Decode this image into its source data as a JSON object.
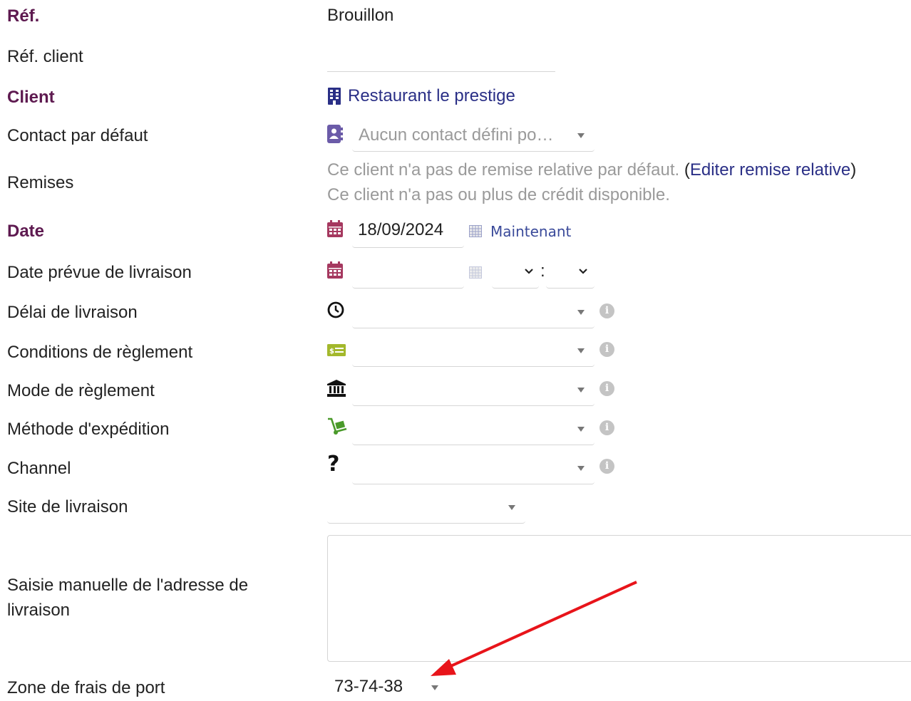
{
  "labels": {
    "ref": "Réf.",
    "ref_client": "Réf. client",
    "client": "Client",
    "contact": "Contact par défaut",
    "remises": "Remises",
    "date": "Date",
    "date_livraison": "Date prévue de livraison",
    "delai": "Délai de livraison",
    "conditions": "Conditions de règlement",
    "mode": "Mode de règlement",
    "methode": "Méthode d'expédition",
    "channel": "Channel",
    "site": "Site de livraison",
    "adresse_line1": "Saisie manuelle de l'adresse de",
    "adresse_line2": "livraison",
    "zone": "Zone de frais de port"
  },
  "values": {
    "ref": "Brouillon",
    "ref_client": "",
    "client_name": "Restaurant le prestige",
    "contact_placeholder": "Aucun contact défini po…",
    "remise_text": "Ce client n'a pas de remise relative par défaut.",
    "remise_link_open": "(",
    "remise_link": "Editer remise relative",
    "remise_link_close": ")",
    "credit_text": "Ce client n'a pas ou plus de crédit disponible.",
    "date": "18/09/2024",
    "now_label": "Maintenant",
    "hour_sep": ":",
    "zone": "73-74-38"
  },
  "colors": {
    "required_label": "#5e1a50",
    "link": "#2a2f86",
    "muted": "#9a9a9a",
    "calendar_icon": "#a5385f",
    "contact_icon": "#6b5ba8",
    "money_icon": "#a3b82c",
    "shipping_icon": "#4a9a2a",
    "annotation_arrow": "#e8141a"
  },
  "icons": {
    "client": "building-icon",
    "contact": "address-book-icon",
    "date": "calendar-icon",
    "now": "calendar-small-icon",
    "delai": "clock-icon",
    "conditions": "money-bill-icon",
    "mode": "bank-icon",
    "methode": "dolly-icon",
    "channel": "question-icon",
    "info": "info-icon"
  }
}
